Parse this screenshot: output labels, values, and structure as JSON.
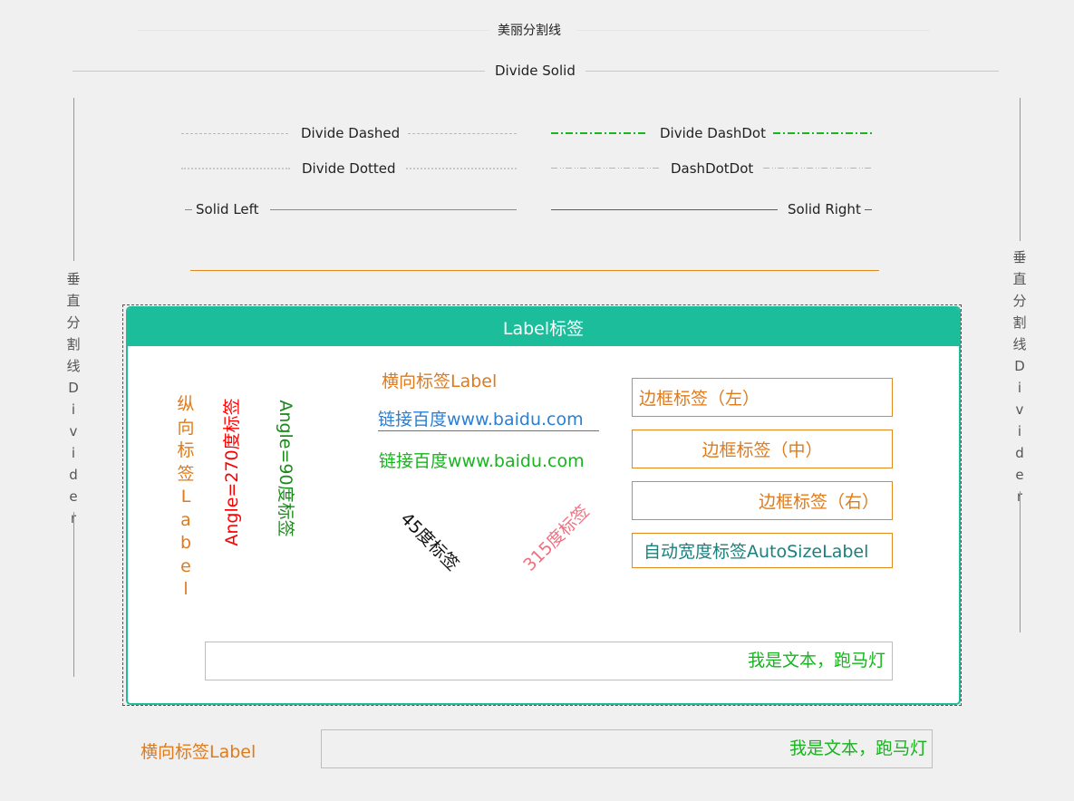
{
  "dividers": {
    "beautiful": "美丽分割线",
    "solid": "Divide Solid",
    "dashed": "Divide Dashed",
    "dashdot": "Divide DashDot",
    "dotted": "Divide Dotted",
    "dashdotdot": "DashDotDot",
    "solid_left": "Solid Left",
    "solid_right": "Solid Right",
    "vertical_left": [
      "垂",
      "直",
      "分",
      "割",
      "线",
      "D",
      "i",
      "v",
      "i",
      "d",
      "e",
      "r"
    ],
    "vertical_right": [
      "垂",
      "直",
      "分",
      "割",
      "线",
      "D",
      "i",
      "v",
      "i",
      "d",
      "e",
      "r"
    ]
  },
  "colors": {
    "orange": "#e08a1e",
    "teal": "#1bbd9a",
    "green": "#17b51e",
    "cyan": "#1fb3c9",
    "blue_link": "#2a7fd6",
    "red": "#ff0000",
    "darkgreen": "#1a8a1a",
    "pink": "#f07080"
  },
  "panel": {
    "title": "Label标签",
    "vertical_label": [
      "纵",
      "向",
      "标",
      "签",
      "L",
      "a",
      "b",
      "e",
      "l"
    ],
    "angle270": "Angle=270度标签",
    "angle90": "Angle=90度标签",
    "horizontal_label": "横向标签Label",
    "link1": "链接百度www.baidu.com",
    "link2": "链接百度www.baidu.com",
    "angle45": "45度标签",
    "angle315": "315度标签",
    "frame_left": "边框标签（左）",
    "frame_center": "边框标签（中）",
    "frame_right": "边框标签（右）",
    "autosize": "自动宽度标签AutoSizeLabel",
    "marquee_text": "我是文本，跑马灯"
  },
  "bottom": {
    "horizontal_label": "横向标签Label",
    "marquee_text": "我是文本，跑马灯"
  }
}
